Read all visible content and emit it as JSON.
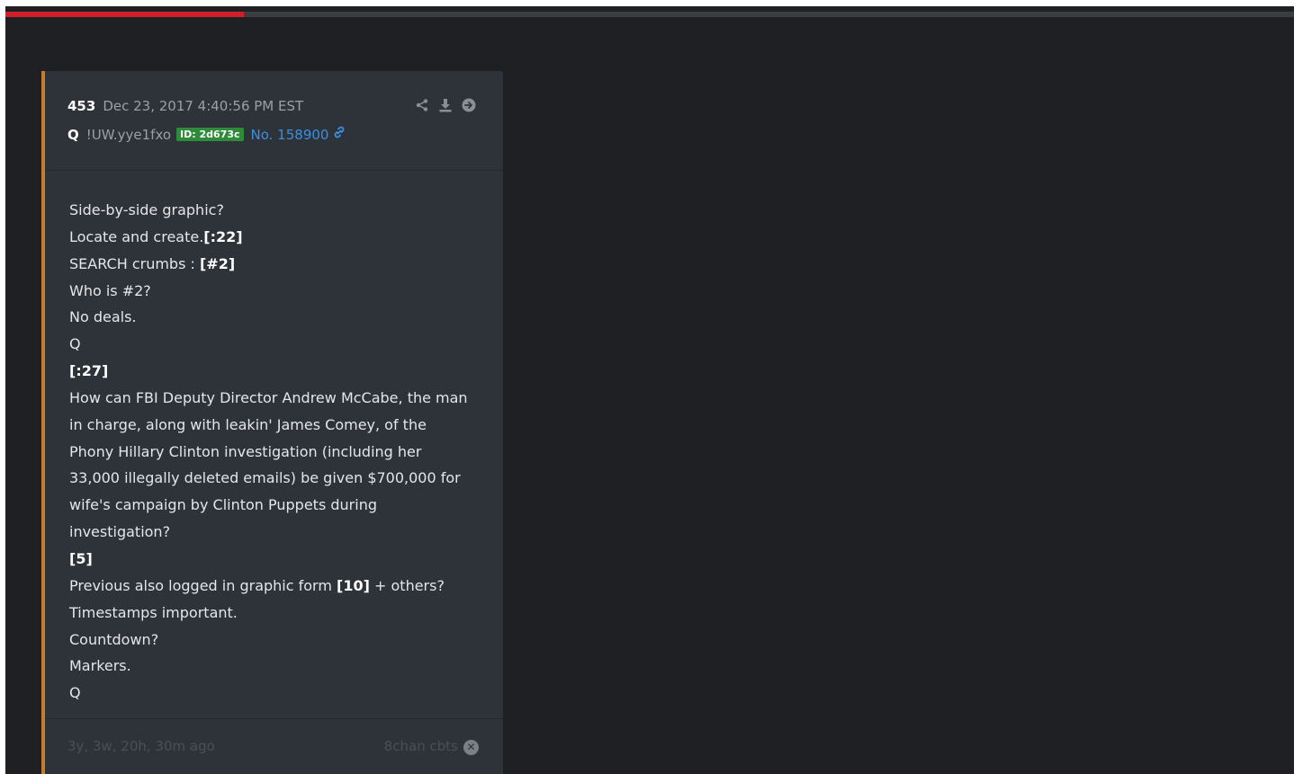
{
  "progress": {
    "fraction": 0.185,
    "fill_color": "#d0202a",
    "track_color": "#3b3d42"
  },
  "post": {
    "number": "453",
    "timestamp": "Dec 23, 2017 4:40:56 PM EST",
    "author": "Q",
    "tripcode": "!UW.yye1fxo",
    "id_badge": "ID: 2d673c",
    "post_link": "No. 158900",
    "accent_color": "#c97c2e",
    "icons": [
      "share-icon",
      "download-icon",
      "next-arrow-icon",
      "link-icon",
      "close-circle-icon"
    ],
    "lines": [
      [
        {
          "t": "Side-by-side graphic?"
        }
      ],
      [
        {
          "t": "Locate and create."
        },
        {
          "t": "[:22]",
          "b": true
        }
      ],
      [
        {
          "t": "SEARCH crumbs : "
        },
        {
          "t": "[#2]",
          "b": true
        }
      ],
      [
        {
          "t": "Who is #2?"
        }
      ],
      [
        {
          "t": "No deals."
        }
      ],
      [
        {
          "t": "Q"
        }
      ],
      [
        {
          "t": "[:27]",
          "b": true
        }
      ],
      [
        {
          "t": "How can FBI Deputy Director Andrew McCabe, the man"
        }
      ],
      [
        {
          "t": "in charge, along with leakin' James Comey, of the"
        }
      ],
      [
        {
          "t": "Phony Hillary Clinton investigation (including her"
        }
      ],
      [
        {
          "t": "33,000 illegally deleted emails) be given $700,000 for"
        }
      ],
      [
        {
          "t": "wife's campaign by Clinton Puppets during"
        }
      ],
      [
        {
          "t": "investigation?"
        }
      ],
      [
        {
          "t": "[5]",
          "b": true
        }
      ],
      [
        {
          "t": "Previous also logged in graphic form "
        },
        {
          "t": "[10]",
          "b": true
        },
        {
          "t": " + others?"
        }
      ],
      [
        {
          "t": "Timestamps important."
        }
      ],
      [
        {
          "t": "Countdown?"
        }
      ],
      [
        {
          "t": "Markers."
        }
      ],
      [
        {
          "t": "Q"
        }
      ]
    ],
    "age": "3y, 3w, 20h, 30m ago",
    "source": "8chan cbts"
  }
}
